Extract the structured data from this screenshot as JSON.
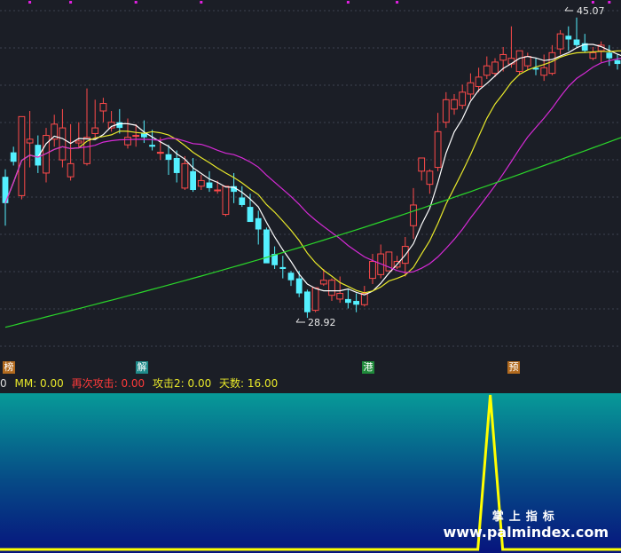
{
  "chart_data": [
    {
      "type": "candlestick",
      "annotations": {
        "high_label": "45.07",
        "low_label": "28.92"
      },
      "ma_colors": {
        "ma5": "#ffffff",
        "ma10": "#e8e82a",
        "ma20": "#d62ad6",
        "ma60": "#2ad62a"
      },
      "up_color": "#ff4a4a",
      "down_color": "#54f0ff",
      "candles": [
        [
          36.6,
          37.0,
          34.0,
          35.2
        ],
        [
          37.9,
          38.2,
          37.2,
          37.4
        ],
        [
          35.6,
          39.8,
          35.4,
          39.8
        ],
        [
          38.4,
          40.1,
          37.1,
          38.6
        ],
        [
          38.3,
          38.8,
          36.8,
          37.2
        ],
        [
          36.8,
          39.2,
          36.3,
          38.8
        ],
        [
          38.6,
          39.9,
          38.2,
          39.4
        ],
        [
          37.5,
          40.2,
          37.1,
          39.2
        ],
        [
          36.6,
          39.4,
          36.4,
          37.3
        ],
        [
          38.4,
          39.5,
          38.1,
          38.5
        ],
        [
          37.3,
          41.3,
          37.2,
          38.7
        ],
        [
          38.9,
          40.7,
          38.6,
          39.2
        ],
        [
          40.1,
          40.8,
          39.5,
          40.5
        ],
        [
          39.2,
          40.1,
          39.0,
          39.5
        ],
        [
          39.5,
          40.2,
          38.9,
          39.2
        ],
        [
          38.3,
          39.7,
          38.1,
          38.7
        ],
        [
          38.8,
          39.4,
          38.2,
          38.8
        ],
        [
          38.9,
          39.6,
          38.4,
          38.7
        ],
        [
          38.3,
          39.1,
          38.0,
          38.2
        ],
        [
          37.9,
          38.7,
          37.5,
          37.9
        ],
        [
          37.8,
          38.3,
          36.7,
          37.5
        ],
        [
          37.6,
          38.0,
          36.3,
          36.8
        ],
        [
          36.0,
          37.7,
          35.9,
          37.3
        ],
        [
          36.9,
          37.6,
          35.8,
          35.9
        ],
        [
          36.1,
          36.7,
          35.9,
          36.4
        ],
        [
          36.3,
          36.9,
          35.8,
          36.0
        ],
        [
          35.9,
          36.4,
          35.7,
          35.9
        ],
        [
          34.6,
          36.1,
          34.5,
          36.1
        ],
        [
          36.1,
          36.8,
          35.2,
          35.8
        ],
        [
          35.5,
          36.1,
          35.0,
          35.1
        ],
        [
          35.0,
          35.7,
          34.3,
          34.2
        ],
        [
          34.4,
          34.8,
          33.0,
          33.8
        ],
        [
          33.8,
          33.9,
          32.4,
          32.0
        ],
        [
          32.5,
          32.9,
          31.7,
          31.9
        ],
        [
          31.8,
          32.4,
          31.2,
          31.7
        ],
        [
          31.5,
          31.6,
          30.8,
          31.1
        ],
        [
          31.2,
          31.6,
          30.2,
          30.4
        ],
        [
          30.5,
          30.6,
          29.1,
          29.4
        ],
        [
          29.5,
          30.7,
          29.4,
          30.7
        ],
        [
          30.9,
          31.7,
          30.8,
          31.1
        ],
        [
          30.3,
          31.2,
          30.0,
          31.1
        ],
        [
          30.1,
          31.3,
          29.9,
          30.4
        ],
        [
          30.1,
          30.6,
          29.6,
          29.9
        ],
        [
          30.0,
          30.4,
          29.4,
          29.8
        ],
        [
          29.8,
          30.8,
          29.7,
          30.4
        ],
        [
          31.2,
          32.5,
          30.9,
          32.1
        ],
        [
          31.4,
          33.0,
          31.2,
          32.5
        ],
        [
          31.6,
          32.6,
          31.6,
          32.6
        ],
        [
          31.8,
          32.4,
          31.7,
          32.1
        ],
        [
          32.0,
          33.4,
          31.3,
          32.9
        ],
        [
          34.0,
          36.0,
          33.3,
          35.1
        ],
        [
          36.9,
          37.6,
          36.4,
          37.6
        ],
        [
          36.2,
          37.0,
          35.7,
          36.9
        ],
        [
          37.1,
          40.0,
          36.9,
          39.0
        ],
        [
          39.5,
          41.1,
          39.2,
          40.7
        ],
        [
          40.2,
          41.0,
          39.9,
          40.7
        ],
        [
          40.4,
          41.5,
          40.2,
          41.1
        ],
        [
          41.0,
          42.1,
          40.7,
          41.6
        ],
        [
          41.4,
          42.4,
          41.1,
          41.9
        ],
        [
          42.0,
          43.0,
          41.8,
          42.5
        ],
        [
          42.1,
          42.9,
          41.9,
          42.7
        ],
        [
          42.8,
          43.5,
          42.2,
          43.1
        ],
        [
          42.6,
          44.6,
          42.4,
          42.9
        ],
        [
          42.2,
          43.2,
          42.0,
          43.3
        ],
        [
          42.5,
          43.2,
          42.3,
          43.0
        ],
        [
          42.4,
          42.9,
          42.0,
          42.3
        ],
        [
          42.0,
          43.1,
          41.7,
          42.4
        ],
        [
          42.1,
          43.6,
          42.0,
          43.2
        ],
        [
          43.4,
          44.4,
          43.1,
          44.2
        ],
        [
          44.1,
          44.6,
          43.3,
          43.9
        ],
        [
          43.9,
          45.07,
          43.5,
          43.6
        ],
        [
          43.7,
          44.2,
          43.2,
          43.3
        ],
        [
          42.9,
          43.5,
          42.8,
          43.2
        ],
        [
          43.3,
          43.8,
          42.7,
          43.6
        ],
        [
          43.2,
          43.6,
          42.5,
          42.9
        ],
        [
          42.8,
          43.1,
          42.3,
          42.6
        ],
        [
          42.3,
          42.8,
          42.0,
          42.5
        ]
      ]
    },
    {
      "type": "line",
      "line_color": "#ffff00",
      "spike_index": 60,
      "spike_value": 1,
      "values_count": 76
    }
  ],
  "markers": [
    {
      "text": "榜",
      "bg": "#b26a1e"
    },
    {
      "text": "解",
      "bg": "#1f8a8a"
    },
    {
      "text": "港",
      "bg": "#1f8a3a"
    },
    {
      "text": "预",
      "bg": "#b26a1e"
    }
  ],
  "indicator": {
    "prefix": "0",
    "mm": "MM: 0.00",
    "zaici": "再次攻击: 0.00",
    "gongji2": "攻击2: 0.00",
    "tianshu": "天数: 16.00"
  },
  "watermark": {
    "cn": "掌上指标",
    "url": "www.palmindex.com"
  }
}
